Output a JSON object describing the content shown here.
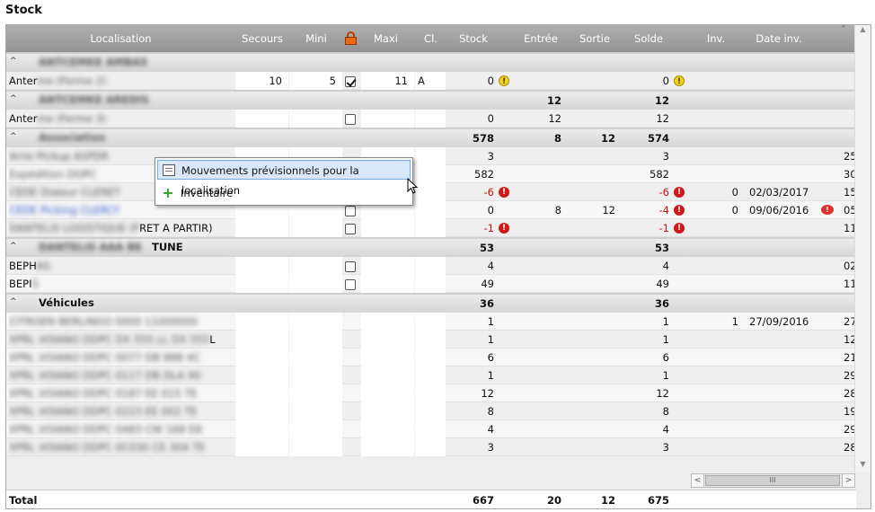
{
  "title": "Stock",
  "header": {
    "localisation": "Localisation",
    "secours": "Secours",
    "mini": "Mini",
    "maxi": "Maxi",
    "cl": "Cl.",
    "stock": "Stock",
    "entree": "Entrée",
    "sortie": "Sortie",
    "solde": "Solde",
    "inv": "Inv.",
    "date_inv": "Date inv."
  },
  "rows": [
    {
      "type": "group",
      "name": "ANTCEMKE AMBAS",
      "blur": true,
      "stock": "",
      "entree": "",
      "sortie": "",
      "solde": ""
    },
    {
      "type": "item",
      "name_prefix": "Anter",
      "name": "ine (Ferme 2)",
      "secours": "10",
      "mini": "5",
      "checked": true,
      "maxi": "11",
      "cl": "A",
      "stock": "0",
      "stock_icon": "warn-yellow",
      "entree": "",
      "sortie": "",
      "solde": "0",
      "solde_icon": "warn-yellow",
      "inv": "",
      "date_inv": "",
      "extra": ""
    },
    {
      "type": "group",
      "name": "ANTCEMKE AREDIS",
      "blur": true,
      "stock": "",
      "entree": "12",
      "sortie": "",
      "solde": "12"
    },
    {
      "type": "item",
      "name_prefix": "Anter",
      "name": "ine (Ferme 3)",
      "secours": "",
      "mini": "",
      "checked": false,
      "maxi": "",
      "cl": "",
      "stock": "0",
      "entree": "12",
      "sortie": "",
      "solde": "12",
      "inv": "",
      "date_inv": "",
      "extra": ""
    },
    {
      "type": "group",
      "name": "Association",
      "blur": true,
      "stock": "578",
      "entree": "8",
      "sortie": "12",
      "solde": "574"
    },
    {
      "type": "item",
      "hl": true,
      "name_prefix": "",
      "name": "Arrie Pickup ASPDR",
      "secours": "",
      "mini": "",
      "checked": null,
      "maxi": "",
      "cl": "",
      "stock": "3",
      "entree": "",
      "sortie": "",
      "solde": "3",
      "inv": "",
      "date_inv": "",
      "extra": "25"
    },
    {
      "type": "item",
      "name_prefix": "",
      "name": "Expédition DOPC",
      "secours": "",
      "mini": "",
      "checked": null,
      "maxi": "",
      "cl": "",
      "stock": "582",
      "entree": "",
      "sortie": "",
      "solde": "582",
      "inv": "",
      "date_inv": "",
      "extra": "30"
    },
    {
      "type": "item",
      "name_prefix": "",
      "name": "CEDE Dialeur CLERET",
      "secours": "",
      "mini": "",
      "checked": null,
      "maxi": "",
      "cl": "",
      "stock": "-6",
      "stock_icon": "warn-red",
      "entree": "",
      "sortie": "",
      "solde": "-6",
      "solde_icon": "warn-red",
      "inv": "0",
      "date_inv": "02/03/2017",
      "extra": "15"
    },
    {
      "type": "item",
      "blue": true,
      "name_prefix": "",
      "name": "CEDE Picking CLERCY",
      "secours": "",
      "mini": "",
      "checked": false,
      "maxi": "",
      "cl": "",
      "stock": "0",
      "entree": "8",
      "sortie": "12",
      "solde": "-4",
      "solde_icon": "warn-red",
      "inv": "0",
      "date_inv": "09/06/2016",
      "bubble": true,
      "extra": "05"
    },
    {
      "type": "item",
      "name_prefix": "",
      "name": "DANTELIS LOGISTIQUE (P",
      "name_suffix": "RET A PARTIR)",
      "secours": "",
      "mini": "",
      "checked": false,
      "maxi": "",
      "cl": "",
      "stock": "-1",
      "stock_icon": "warn-red",
      "entree": "",
      "sortie": "",
      "solde": "-1",
      "solde_icon": "warn-red",
      "inv": "",
      "date_inv": "",
      "extra": "11"
    },
    {
      "type": "group",
      "name": "DANTELIS AAA BE",
      "name_suffix": "TUNE",
      "blur": true,
      "stock": "53",
      "entree": "",
      "sortie": "",
      "solde": "53"
    },
    {
      "type": "item",
      "name_prefix": "BEPH",
      "name": "AS",
      "secours": "",
      "mini": "",
      "checked": false,
      "maxi": "",
      "cl": "",
      "stock": "4",
      "entree": "",
      "sortie": "",
      "solde": "4",
      "inv": "",
      "date_inv": "",
      "extra": "02"
    },
    {
      "type": "item",
      "name_prefix": "BEPI",
      "name": "S",
      "secours": "",
      "mini": "",
      "checked": false,
      "maxi": "",
      "cl": "",
      "stock": "49",
      "entree": "",
      "sortie": "",
      "solde": "49",
      "inv": "",
      "date_inv": "",
      "extra": "11"
    },
    {
      "type": "group",
      "name": "Véhicules",
      "blur": false,
      "stock": "36",
      "entree": "",
      "sortie": "",
      "solde": "36"
    },
    {
      "type": "item",
      "name_prefix": "",
      "name": "CITROEN BERLINGO 0000 11000000",
      "secours": "",
      "mini": "",
      "checked": null,
      "maxi": "",
      "cl": "",
      "stock": "1",
      "entree": "",
      "sortie": "",
      "solde": "1",
      "inv": "1",
      "date_inv": "27/09/2016",
      "extra": "27"
    },
    {
      "type": "item",
      "name_prefix": "",
      "name": "XPRL VOIANO DDPC DX 555 LL DX 555",
      "name_suffix": "L",
      "secours": "",
      "mini": "",
      "checked": null,
      "maxi": "",
      "cl": "",
      "stock": "1",
      "entree": "",
      "sortie": "",
      "solde": "1",
      "inv": "",
      "date_inv": "",
      "extra": "12"
    },
    {
      "type": "item",
      "name_prefix": "",
      "name": "XPRL VOIANO DDPC 0077 DB 888 4C",
      "secours": "",
      "mini": "",
      "checked": null,
      "maxi": "",
      "cl": "",
      "stock": "6",
      "entree": "",
      "sortie": "",
      "solde": "6",
      "inv": "",
      "date_inv": "",
      "extra": "21"
    },
    {
      "type": "item",
      "name_prefix": "",
      "name": "XPRL VOIANO DDPC 0117 DB DLA 90",
      "secours": "",
      "mini": "",
      "checked": null,
      "maxi": "",
      "cl": "",
      "stock": "1",
      "entree": "",
      "sortie": "",
      "solde": "1",
      "inv": "",
      "date_inv": "",
      "extra": "29"
    },
    {
      "type": "item",
      "name_prefix": "",
      "name": "XPRL VOIANO DDPC 0187 EE 015 TE",
      "secours": "",
      "mini": "",
      "checked": null,
      "maxi": "",
      "cl": "",
      "stock": "12",
      "entree": "",
      "sortie": "",
      "solde": "12",
      "inv": "",
      "date_inv": "",
      "extra": "28"
    },
    {
      "type": "item",
      "name_prefix": "",
      "name": "XPRL VOIANO DDPC 0223 EE 002 TE",
      "secours": "",
      "mini": "",
      "checked": null,
      "maxi": "",
      "cl": "",
      "stock": "8",
      "entree": "",
      "sortie": "",
      "solde": "8",
      "inv": "",
      "date_inv": "",
      "extra": "19"
    },
    {
      "type": "item",
      "name_prefix": "",
      "name": "XPRL VOIANO DDPC 0483 CW 168 E8",
      "secours": "",
      "mini": "",
      "checked": null,
      "maxi": "",
      "cl": "",
      "stock": "4",
      "entree": "",
      "sortie": "",
      "solde": "4",
      "inv": "",
      "date_inv": "",
      "extra": "29"
    },
    {
      "type": "item",
      "name_prefix": "",
      "name": "XPRL VOIANO DDPC 0C030 CE 304 TE",
      "secours": "",
      "mini": "",
      "checked": null,
      "maxi": "",
      "cl": "",
      "stock": "3",
      "entree": "",
      "sortie": "",
      "solde": "3",
      "inv": "",
      "date_inv": "",
      "extra": "28"
    }
  ],
  "total": {
    "label": "Total",
    "stock": "667",
    "entree": "20",
    "sortie": "12",
    "solde": "675"
  },
  "context_menu": {
    "items": [
      "Mouvements prévisionnels pour la localisation",
      "Inventaire"
    ]
  },
  "scroll": {
    "thumb": "III",
    "left": "<",
    "right": ">"
  }
}
